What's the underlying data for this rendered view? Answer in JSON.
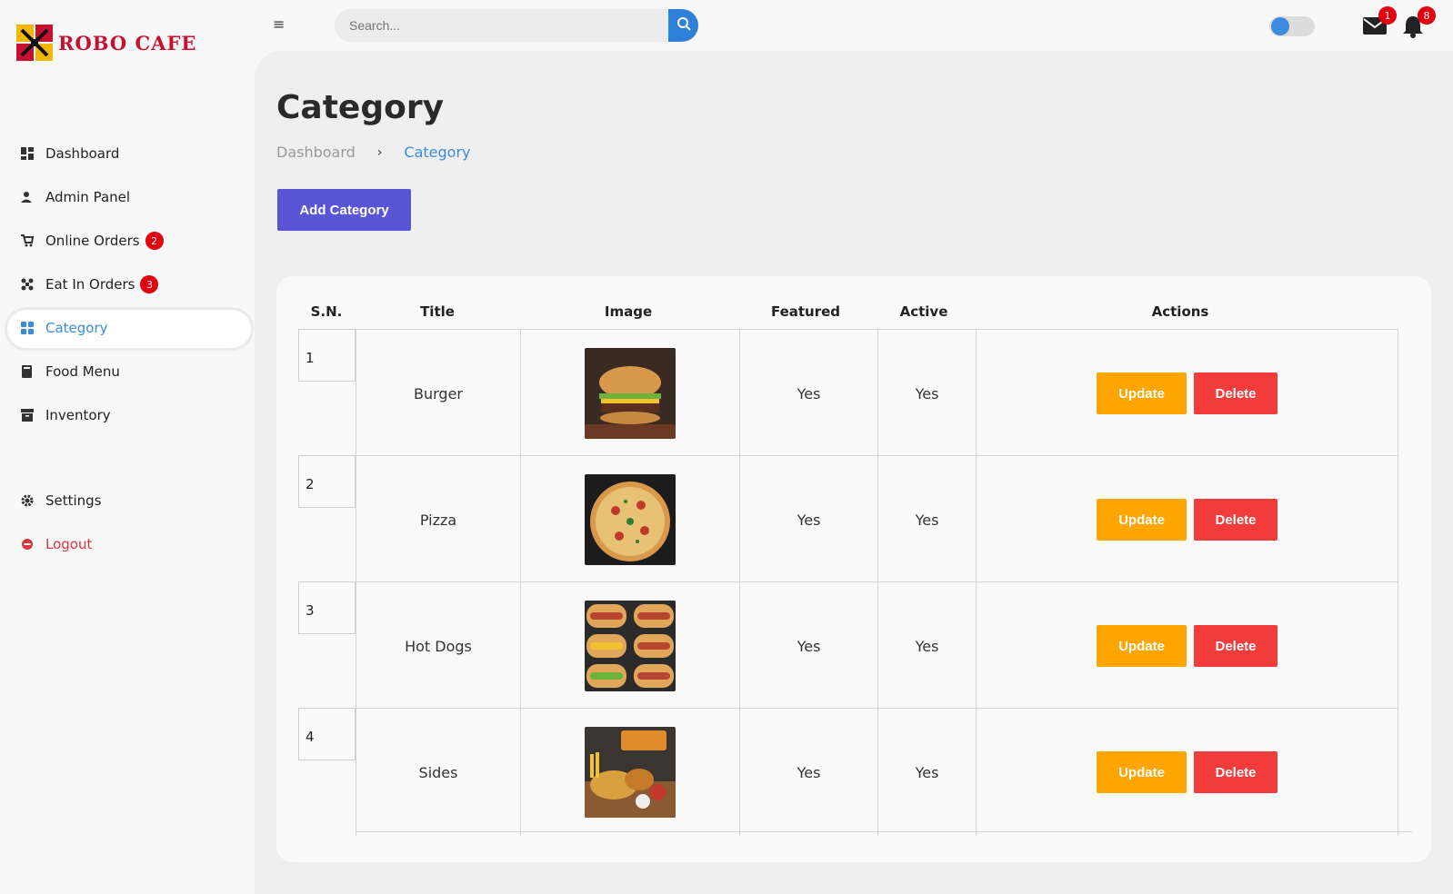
{
  "brand": {
    "name": "ROBO CAFE"
  },
  "sidebar": {
    "items": [
      {
        "label": "Dashboard",
        "icon": "dashboard-icon"
      },
      {
        "label": "Admin Panel",
        "icon": "user-icon"
      },
      {
        "label": "Online Orders",
        "icon": "cart-icon",
        "badge": "2"
      },
      {
        "label": "Eat In Orders",
        "icon": "dining-icon",
        "badge": "3"
      },
      {
        "label": "Category",
        "icon": "grid-icon",
        "active": true
      },
      {
        "label": "Food Menu",
        "icon": "book-icon"
      },
      {
        "label": "Inventory",
        "icon": "archive-icon"
      },
      {
        "label": "Settings",
        "icon": "gear-icon"
      },
      {
        "label": "Logout",
        "icon": "logout-icon"
      }
    ]
  },
  "topbar": {
    "search_placeholder": "Search...",
    "mail_count": "1",
    "notification_count": "8"
  },
  "page": {
    "title": "Category",
    "breadcrumb": [
      "Dashboard",
      "Category"
    ],
    "add_button": "Add Category"
  },
  "table": {
    "headers": [
      "S.N.",
      "Title",
      "Image",
      "Featured",
      "Active",
      "Actions"
    ],
    "rows": [
      {
        "sn": "1",
        "title": "Burger",
        "featured": "Yes",
        "active": "Yes"
      },
      {
        "sn": "2",
        "title": "Pizza",
        "featured": "Yes",
        "active": "Yes"
      },
      {
        "sn": "3",
        "title": "Hot Dogs",
        "featured": "Yes",
        "active": "Yes"
      },
      {
        "sn": "4",
        "title": "Sides",
        "featured": "Yes",
        "active": "Yes"
      }
    ],
    "update_label": "Update",
    "delete_label": "Delete"
  },
  "colors": {
    "accent": "#3b8be0",
    "primary_button": "#5a55d6",
    "update": "#ffa500",
    "delete": "#f23b3b",
    "badge": "#e3000f"
  }
}
